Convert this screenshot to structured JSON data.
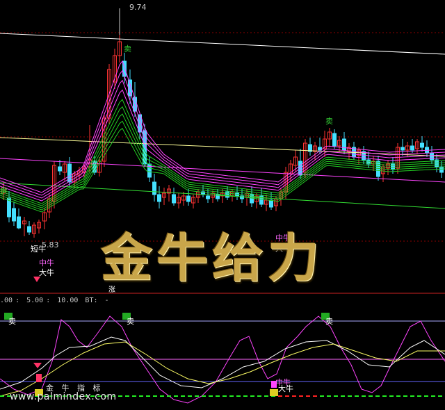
{
  "chart_data": [
    {
      "type": "candlestick",
      "annotations": {
        "high_label": "9.74",
        "low_label": "5.83",
        "sell_label": "卖",
        "long_label": "短牛",
        "mid_label": "中牛",
        "big_label": "大牛",
        "rise_label": "涨"
      },
      "title_banner": "金牛给力",
      "colors": {
        "up": "#ff3333",
        "down": "#44e0ff",
        "ma_magenta": "#ff44ff",
        "ma_green": "#22cc22",
        "long_yellow": "#ffff99",
        "long_white": "#ffffff",
        "long_green": "#33dd33",
        "sell": "#33cc33"
      }
    },
    {
      "type": "line",
      "toolbar": [
        ".00",
        "5.00",
        "10.00",
        "BT:",
        "-"
      ],
      "indicator_title": "金 牛 指 标",
      "sell_label": "卖",
      "mid_label": "中牛",
      "big_label": "大牛",
      "colors": {
        "magenta": "#ff44ff",
        "white": "#ffffff",
        "yellow": "#ffff66",
        "band_top": "#aaaaff",
        "band_mid": "#ff66ff",
        "band_bot": "#6666ff",
        "dash_green": "#22ee22",
        "dash_red": "#ff2222"
      }
    }
  ],
  "watermark": "www.palmindex.com"
}
